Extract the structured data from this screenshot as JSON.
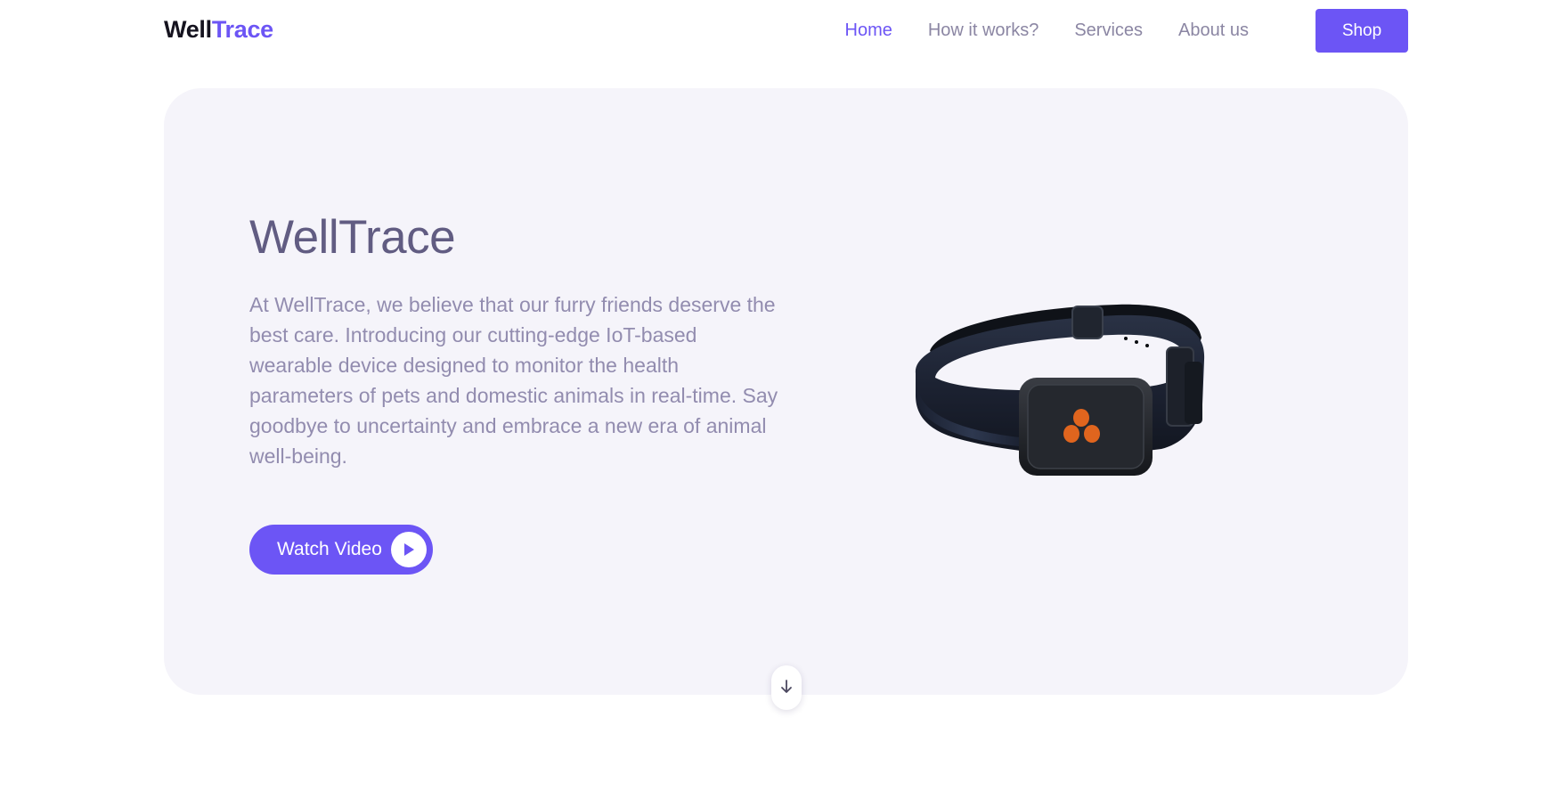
{
  "brand": {
    "part1": "Well",
    "part2": "Trace"
  },
  "nav": {
    "items": [
      {
        "label": "Home",
        "active": true
      },
      {
        "label": "How it works?"
      },
      {
        "label": "Services"
      },
      {
        "label": "About us"
      }
    ],
    "shop_label": "Shop"
  },
  "hero": {
    "title": "WellTrace",
    "description": "At WellTrace, we believe that our furry friends deserve the best care. Introducing our cutting-edge IoT-based wearable device designed to monitor the health parameters of pets and domestic animals in real-time. Say goodbye to uncertainty and embrace a new era of animal well-being.",
    "watch_label": "Watch Video",
    "watch_icon": "play-icon",
    "image": "pet-collar-device"
  },
  "scroll_icon": "arrow-down-icon",
  "colors": {
    "accent": "#6c55f5",
    "hero_bg": "#f5f4fa",
    "title": "#615c82",
    "body_text": "#928caf",
    "device_logo": "#e0651e"
  }
}
